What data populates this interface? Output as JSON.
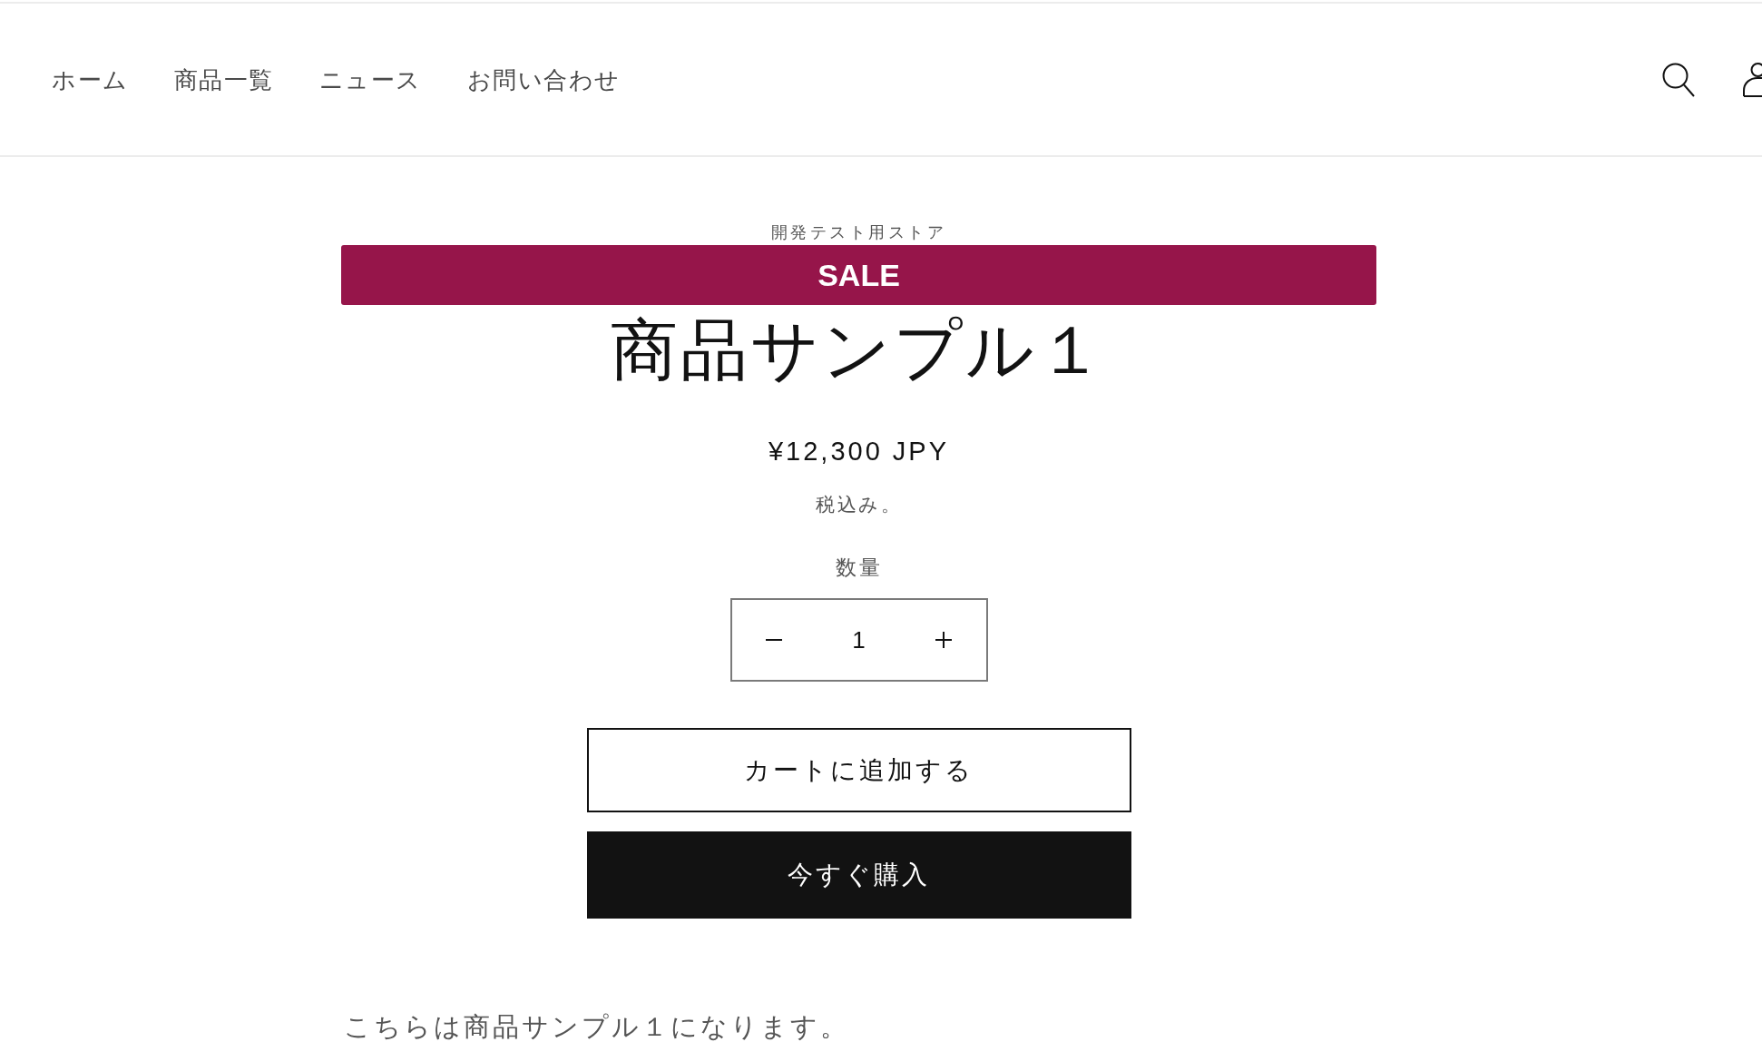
{
  "header": {
    "nav": [
      {
        "label": "ホーム"
      },
      {
        "label": "商品一覧"
      },
      {
        "label": "ニュース"
      },
      {
        "label": "お問い合わせ"
      }
    ]
  },
  "product": {
    "vendor": "開発テスト用ストア",
    "badge": "SALE",
    "title": "商品サンプル１",
    "price": "¥12,300 JPY",
    "tax_note": "税込み。",
    "quantity": {
      "label": "数量",
      "value": "1"
    },
    "buttons": [
      {
        "label": "カートに追加する",
        "kind": "outline"
      },
      {
        "label": "今すぐ購入",
        "kind": "filled"
      }
    ],
    "description": "こちらは商品サンプル１になります。"
  }
}
